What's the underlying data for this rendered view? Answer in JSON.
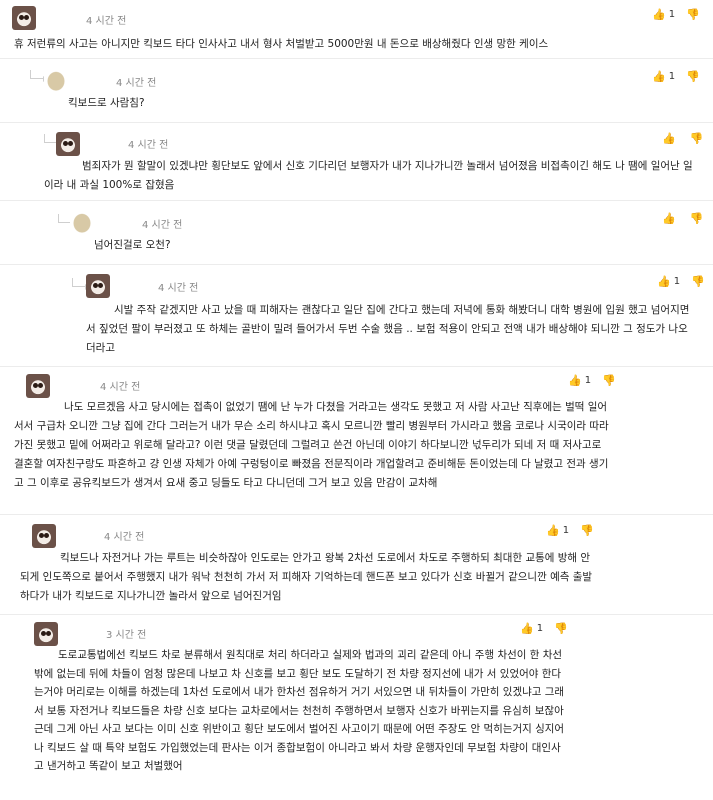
{
  "comments": [
    {
      "time": "4 시간 전",
      "likes": "1",
      "text": "휴 저런류의 사고는 아니지만 킥보드 타다 인사사고 내서 형사 처벌받고 5000만원 내 돈으로 배상해줬다 인생 망한 케이스"
    },
    {
      "time": "4 시간 전",
      "likes": "1",
      "text": "킥보드로 사람침?"
    },
    {
      "time": "4 시간 전",
      "likes": "",
      "text": "범죄자가 뭔 할말이 있겠냐만 횡단보도 앞에서 신호 기다리던 보행자가 내가 지나가니깐 놀래서 넘어졌음 비접촉이긴 해도 나 땜에 일어난 일이라 내 과실 100%로 잡혔음"
    },
    {
      "time": "4 시간 전",
      "likes": "",
      "text": "넘어진걸로 오천?"
    },
    {
      "time": "4 시간 전",
      "likes": "1",
      "text": "시발 주작 같겠지만 사고 났을 때 피해자는 괜찮다고 일단 집에 간다고 했는데 저녁에 통화 해봤더니 대학 병원에 입원 했고 넘어지면서 짚었던 팔이 부러졌고 또 하체는 골반이 밀려 들어가서 두번 수술 했음 .. 보험 적용이 안되고 전액 내가 배상해야 되니깐 그 정도가 나오더라고"
    },
    {
      "time": "4 시간 전",
      "likes": "1",
      "text": "나도 모르겠음 사고 당시에는 접촉이 없었기 땜에 난 누가 다쳤을 거라고는 생각도 못했고 저 사람 사고난 직후에는 벌떡 일어서서 구급차 오니깐 그냥 집에 간다 그러는거 내가 무슨 소리 하시냐고 혹시 모르니깐 빨리 병원부터 가시라고 했음 코로나 시국이라 따라가진 못했고 밑에 어쩌라고 위로해 달라고? 이런 댓글 달렸던데 그럴려고 쓴건 아닌데 이야기 하다보니깐 넋두리가 되네 저 때 저사고로 결혼할 여자친구랑도 파혼하고 걍 인생 자체가 아예 구렁텅이로 빠졌음 전문직이라 개업할려고 준비해둔 돈이었는데 다 날렸고 전과 생기고 그 이후로 공유킥보드가 생겨서 요새 중고 딩들도 타고 다니던데 그거 보고 있음 만감이 교차해"
    },
    {
      "time": "4 시간 전",
      "likes": "1",
      "text": "킥보드나 자전거나 가는 루트는 비슷하잖아 인도로는 안가고 왕복 2차선 도로에서 차도로 주행하되 최대한 교통에 방해 안되게 인도쪽으로 붙어서 주행했지 내가 워낙 천천히 가서 저 피해자 기억하는데 핸드폰 보고 있다가 신호 바뀔거 같으니깐 예측 출발하다가 내가 킥보드로 지나가니깐 놀라서 앞으로 넘어진거임"
    },
    {
      "time": "3 시간 전",
      "likes": "1",
      "text": "도로교통법에선 킥보드 차로 분류해서 원칙대로 처리 하더라고 실제와 법과의 괴리 같은데 아니 주행 차선이 한 차선 밖에 없는데 뒤에 차들이 엄청 많은데 나보고 차 신호를 보고 횡단 보도 도달하기 전 차량 정지선에 내가 서 있었어야 한다는거야 머리로는 이해를 하겠는데 1차선 도로에서 내가 한차선 점유하거 거기 서있으면 내 뒤차들이 가만히 있겠냐고 그래서 보통 자전거나 킥보드들은 차량 신호 보다는 교차로에서는 천천히 주행하면서 보행자 신호가 바뀌는지를 유심히 보잖아 근데 그게 아닌 사고 보다는 이미 신호 위반이고 횡단 보도에서 벌어진 사고이기 때문에 어떤 주장도 안 먹히는거지 싱지어 나 킥보드 살 때 특약 보험도 가입했었는데 판사는 이거 종합보험이 아니라고 봐서 차량 운행자인데 무보험 차량이 대인사고 낸거하고 똑같이 보고 처벌했어"
    }
  ]
}
